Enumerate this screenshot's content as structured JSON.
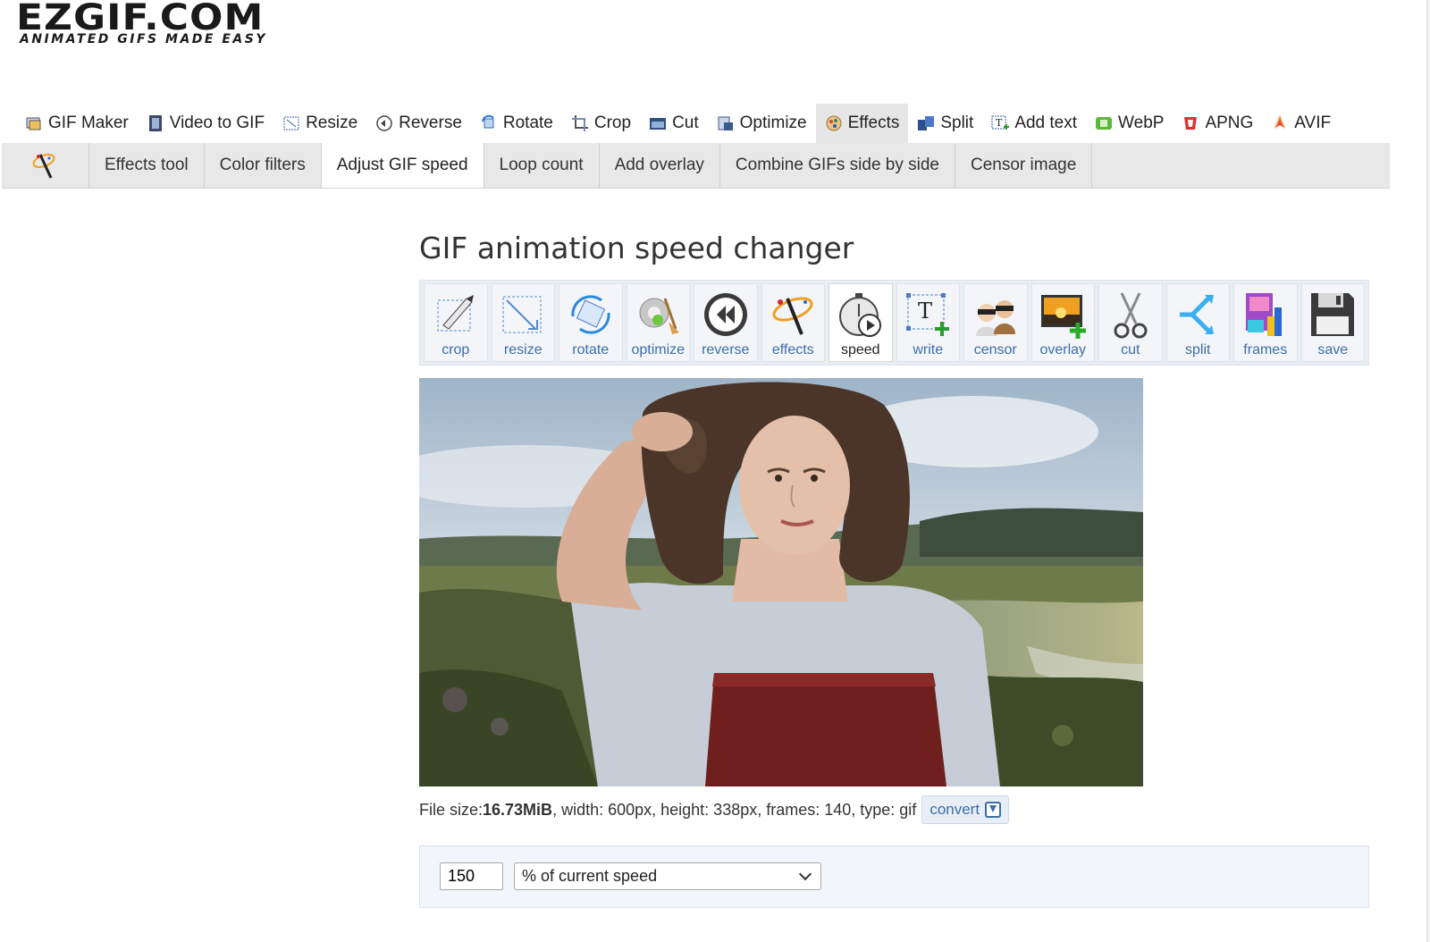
{
  "logo": {
    "main": "EZGIF.COM",
    "tagline": "ANIMATED GIFS MADE EASY"
  },
  "main_nav": [
    {
      "label": "GIF Maker",
      "icon": "gif-maker-icon"
    },
    {
      "label": "Video to GIF",
      "icon": "film-icon"
    },
    {
      "label": "Resize",
      "icon": "resize-icon"
    },
    {
      "label": "Reverse",
      "icon": "reverse-icon"
    },
    {
      "label": "Rotate",
      "icon": "rotate-icon"
    },
    {
      "label": "Crop",
      "icon": "crop-icon"
    },
    {
      "label": "Cut",
      "icon": "cut-icon"
    },
    {
      "label": "Optimize",
      "icon": "optimize-icon"
    },
    {
      "label": "Effects",
      "icon": "effects-icon",
      "active": true
    },
    {
      "label": "Split",
      "icon": "split-icon"
    },
    {
      "label": "Add text",
      "icon": "add-text-icon"
    },
    {
      "label": "WebP",
      "icon": "webp-icon"
    },
    {
      "label": "APNG",
      "icon": "apng-icon"
    },
    {
      "label": "AVIF",
      "icon": "avif-icon"
    }
  ],
  "sub_nav": {
    "icon": "magic-wand-icon",
    "tabs": [
      {
        "label": "Effects tool"
      },
      {
        "label": "Color filters"
      },
      {
        "label": "Adjust GIF speed",
        "active": true
      },
      {
        "label": "Loop count"
      },
      {
        "label": "Add overlay"
      },
      {
        "label": "Combine GIFs side by side"
      },
      {
        "label": "Censor image"
      }
    ]
  },
  "page": {
    "title": "GIF animation speed changer"
  },
  "toolbar": [
    {
      "label": "crop",
      "icon": "crop-tool-icon"
    },
    {
      "label": "resize",
      "icon": "resize-tool-icon"
    },
    {
      "label": "rotate",
      "icon": "rotate-tool-icon"
    },
    {
      "label": "optimize",
      "icon": "optimize-tool-icon"
    },
    {
      "label": "reverse",
      "icon": "reverse-tool-icon"
    },
    {
      "label": "effects",
      "icon": "effects-tool-icon"
    },
    {
      "label": "speed",
      "icon": "speed-tool-icon",
      "active": true
    },
    {
      "label": "write",
      "icon": "write-tool-icon"
    },
    {
      "label": "censor",
      "icon": "censor-tool-icon"
    },
    {
      "label": "overlay",
      "icon": "overlay-tool-icon"
    },
    {
      "label": "cut",
      "icon": "cut-tool-icon"
    },
    {
      "label": "split",
      "icon": "split-tool-icon"
    },
    {
      "label": "frames",
      "icon": "frames-tool-icon"
    },
    {
      "label": "save",
      "icon": "save-tool-icon"
    }
  ],
  "file_info": {
    "size_label": "File size: ",
    "size_value": "16.73MiB",
    "rest": ", width: 600px, height: 338px, frames: 140, type: gif",
    "convert_label": "convert"
  },
  "speed_form": {
    "value": "150",
    "unit_selected": "% of current speed"
  }
}
